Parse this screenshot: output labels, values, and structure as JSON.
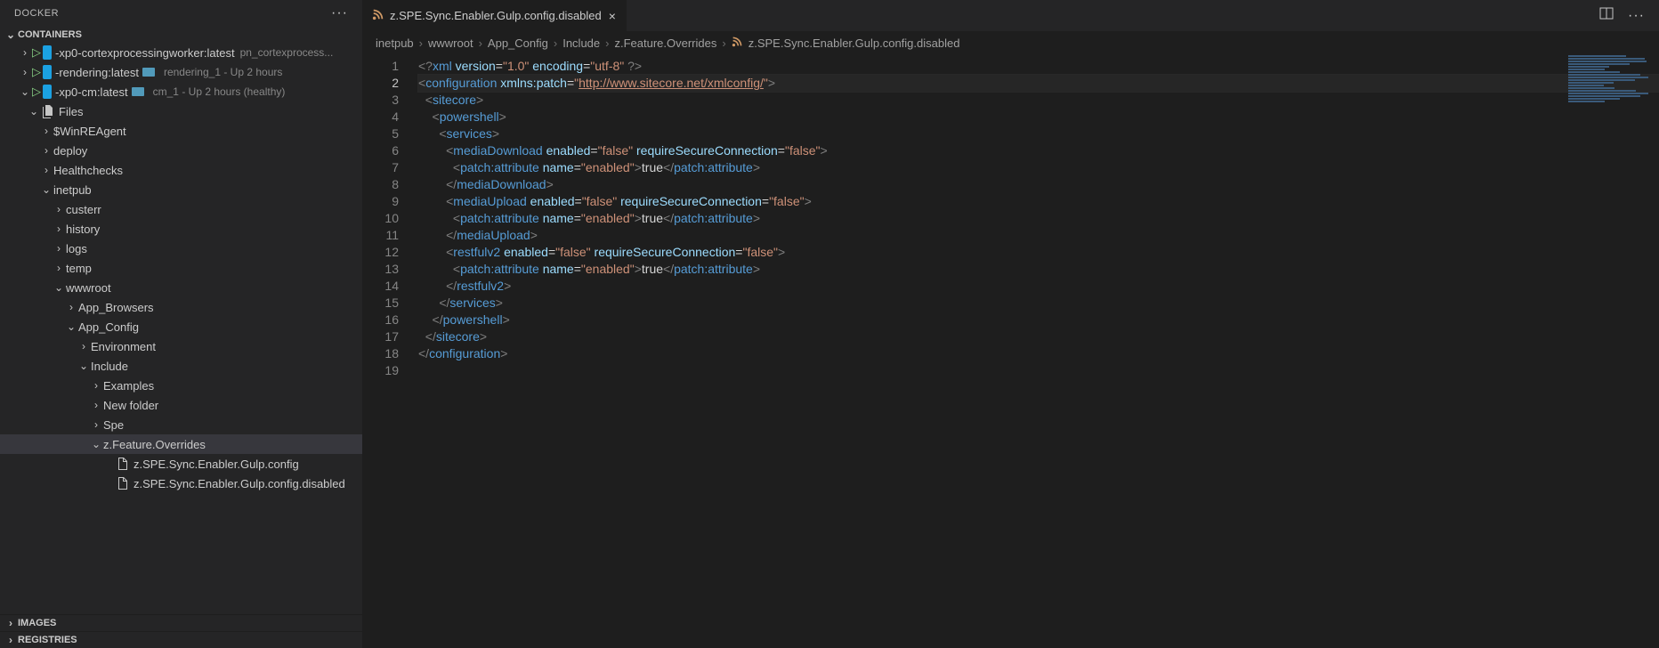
{
  "sidebar": {
    "title": "DOCKER",
    "sections": {
      "containers": "CONTAINERS",
      "images": "IMAGES",
      "registries": "REGISTRIES"
    },
    "containers": [
      {
        "name": "-xp0-cortexprocessingworker:latest",
        "status": "pn_cortexprocess...",
        "type": "container"
      },
      {
        "name": "-rendering:latest",
        "meta": "rendering_1 - Up 2 hours",
        "type": "container"
      },
      {
        "name": "-xp0-cm:latest",
        "meta": "cm_1 - Up 2 hours (healthy)",
        "type": "container"
      }
    ],
    "tree": [
      {
        "label": "Files",
        "depth": 2,
        "icon": "files",
        "chev": "down"
      },
      {
        "label": "$WinREAgent",
        "depth": 3,
        "chev": "right"
      },
      {
        "label": "deploy",
        "depth": 3,
        "chev": "right"
      },
      {
        "label": "Healthchecks",
        "depth": 3,
        "chev": "right"
      },
      {
        "label": "inetpub",
        "depth": 3,
        "chev": "down"
      },
      {
        "label": "custerr",
        "depth": 4,
        "chev": "right"
      },
      {
        "label": "history",
        "depth": 4,
        "chev": "right"
      },
      {
        "label": "logs",
        "depth": 4,
        "chev": "right"
      },
      {
        "label": "temp",
        "depth": 4,
        "chev": "right"
      },
      {
        "label": "wwwroot",
        "depth": 4,
        "chev": "down"
      },
      {
        "label": "App_Browsers",
        "depth": 5,
        "chev": "right"
      },
      {
        "label": "App_Config",
        "depth": 5,
        "chev": "down"
      },
      {
        "label": "Environment",
        "depth": 6,
        "chev": "right"
      },
      {
        "label": "Include",
        "depth": 6,
        "chev": "down"
      },
      {
        "label": "Examples",
        "depth": 7,
        "chev": "right"
      },
      {
        "label": "New folder",
        "depth": 7,
        "chev": "right"
      },
      {
        "label": "Spe",
        "depth": 7,
        "chev": "right"
      },
      {
        "label": "z.Feature.Overrides",
        "depth": 7,
        "chev": "down",
        "selected": true
      },
      {
        "label": "z.SPE.Sync.Enabler.Gulp.config",
        "depth": 8,
        "icon": "file"
      },
      {
        "label": "z.SPE.Sync.Enabler.Gulp.config.disabled",
        "depth": 8,
        "icon": "file"
      }
    ]
  },
  "tab": {
    "label": "z.SPE.Sync.Enabler.Gulp.config.disabled"
  },
  "breadcrumb": [
    "inetpub",
    "wwwroot",
    "App_Config",
    "Include",
    "z.Feature.Overrides",
    "z.SPE.Sync.Enabler.Gulp.config.disabled"
  ],
  "code": {
    "current_line": 2,
    "lines": 19,
    "l1": {
      "a": "<?",
      "b": "xml",
      "c": " version",
      "d": "=",
      "e": "\"1.0\"",
      "f": " encoding",
      "g": "=",
      "h": "\"utf-8\"",
      "i": " ?>"
    },
    "l2": {
      "a": "<",
      "b": "configuration",
      "c": " xmlns:patch",
      "d": "=",
      "e": "\"",
      "url": "http://www.sitecore.net/xmlconfig/",
      "f": "\"",
      "g": ">"
    },
    "l3": {
      "a": "  <",
      "b": "sitecore",
      "c": ">"
    },
    "l4": {
      "a": "    <",
      "b": "powershell",
      "c": ">"
    },
    "l5": {
      "a": "      <",
      "b": "services",
      "c": ">"
    },
    "l6": {
      "a": "        <",
      "b": "mediaDownload",
      "c": " enabled",
      "d": "=",
      "e": "\"false\"",
      "f": " requireSecureConnection",
      "g": "=",
      "h": "\"false\"",
      "i": ">"
    },
    "l7": {
      "a": "          <",
      "b": "patch:attribute",
      "c": " name",
      "d": "=",
      "e": "\"enabled\"",
      "f": ">",
      "g": "true",
      "h": "</",
      "i": "patch:attribute",
      "j": ">"
    },
    "l8": {
      "a": "        </",
      "b": "mediaDownload",
      "c": ">"
    },
    "l9": {
      "a": "        <",
      "b": "mediaUpload",
      "c": " enabled",
      "d": "=",
      "e": "\"false\"",
      "f": " requireSecureConnection",
      "g": "=",
      "h": "\"false\"",
      "i": ">"
    },
    "l10": {
      "a": "          <",
      "b": "patch:attribute",
      "c": " name",
      "d": "=",
      "e": "\"enabled\"",
      "f": ">",
      "g": "true",
      "h": "</",
      "i": "patch:attribute",
      "j": ">"
    },
    "l11": {
      "a": "        </",
      "b": "mediaUpload",
      "c": ">"
    },
    "l12": {
      "a": "        <",
      "b": "restfulv2",
      "c": " enabled",
      "d": "=",
      "e": "\"false\"",
      "f": " requireSecureConnection",
      "g": "=",
      "h": "\"false\"",
      "i": ">"
    },
    "l13": {
      "a": "          <",
      "b": "patch:attribute",
      "c": " name",
      "d": "=",
      "e": "\"enabled\"",
      "f": ">",
      "g": "true",
      "h": "</",
      "i": "patch:attribute",
      "j": ">"
    },
    "l14": {
      "a": "        </",
      "b": "restfulv2",
      "c": ">"
    },
    "l15": {
      "a": "      </",
      "b": "services",
      "c": ">"
    },
    "l16": {
      "a": "    </",
      "b": "powershell",
      "c": ">"
    },
    "l17": {
      "a": "  </",
      "b": "sitecore",
      "c": ">"
    },
    "l18": {
      "a": "</",
      "b": "configuration",
      "c": ">"
    }
  }
}
